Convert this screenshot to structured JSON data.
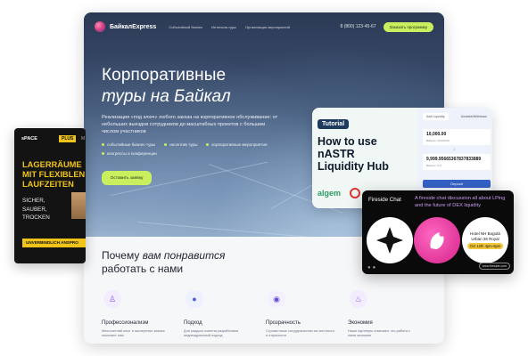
{
  "site": {
    "nav": {
      "logo": "БайкалExpress",
      "links": [
        "Событийный бизнес",
        "Интенсив-туры",
        "Организация мероприятий"
      ],
      "phone": "8 (800) 123-45-67",
      "cta": "Заказать программу"
    },
    "hero": {
      "title_line1": "Корпоративные",
      "title_line2": "туры на Байкал",
      "description": "Реализация «под ключ» любого заказа на корпоративное обслуживание: от небольших выездов сотрудников до масштабных проектов с большим числом участников",
      "bullets": [
        "событийные бизнес-туры",
        "инсентив туры",
        "корпоративные мероприятия",
        "конгрессы и конференции"
      ],
      "cta": "Оставить заявку"
    },
    "why": {
      "line1_prefix": "Почему ",
      "line1_italic": "вам понравится",
      "line2": "работать с нами"
    },
    "features": [
      {
        "title": "Профессионализм",
        "desc": "Многолетний опыт и экспертные знания помогают нам",
        "icon": "people-icon",
        "color": "#f3ecff"
      },
      {
        "title": "Подход",
        "desc": "Для каждого клиента разработаем индивидуальный подход",
        "icon": "user-icon",
        "color": "#eef1ff"
      },
      {
        "title": "Прозрачность",
        "desc": "Строим наше сотрудничество на честности и открытости",
        "icon": "eye-icon",
        "color": "#f4f0ff"
      },
      {
        "title": "Экономия",
        "desc": "Наши партнеры отмечают, что работа с нами экономит",
        "icon": "piggy-bank-icon",
        "color": "#f3ecff"
      }
    ]
  },
  "ad": {
    "logo": "sPACE",
    "logo_plus": "PLUS",
    "nav_letter": "M",
    "headline": [
      "LAGERRÄUME",
      "MIT FLEXIBLEN",
      "LAUFZEITEN"
    ],
    "sub": [
      "SICHER,",
      "SAUBER,",
      "TROCKEN"
    ],
    "button": "UNVERBINDLICH ANSPRO"
  },
  "tutorial": {
    "tag": "Tutorial",
    "title": [
      "How to use",
      "nASTR",
      "Liquidity Hub"
    ],
    "brand": "algem",
    "tabs": [
      "Add Liquidity",
      "Unstake/Withdraw"
    ],
    "field1_value": "10,000.00",
    "field1_note": "Balance: 20,000.00",
    "field2_value": "9,999.95665367837833889",
    "field2_note": "Balance: 0.0",
    "button": "Deposit"
  },
  "fireside": {
    "label": "Fireside Chat",
    "description": "A fireside chat discussion all about LPing and the future of DEX liquidity",
    "hotel": [
      "Hotel NH Bogotá",
      "Urban 26 Royal"
    ],
    "date": "Oct 12th 4pm-6pm",
    "badge": "www.fireside.com"
  }
}
